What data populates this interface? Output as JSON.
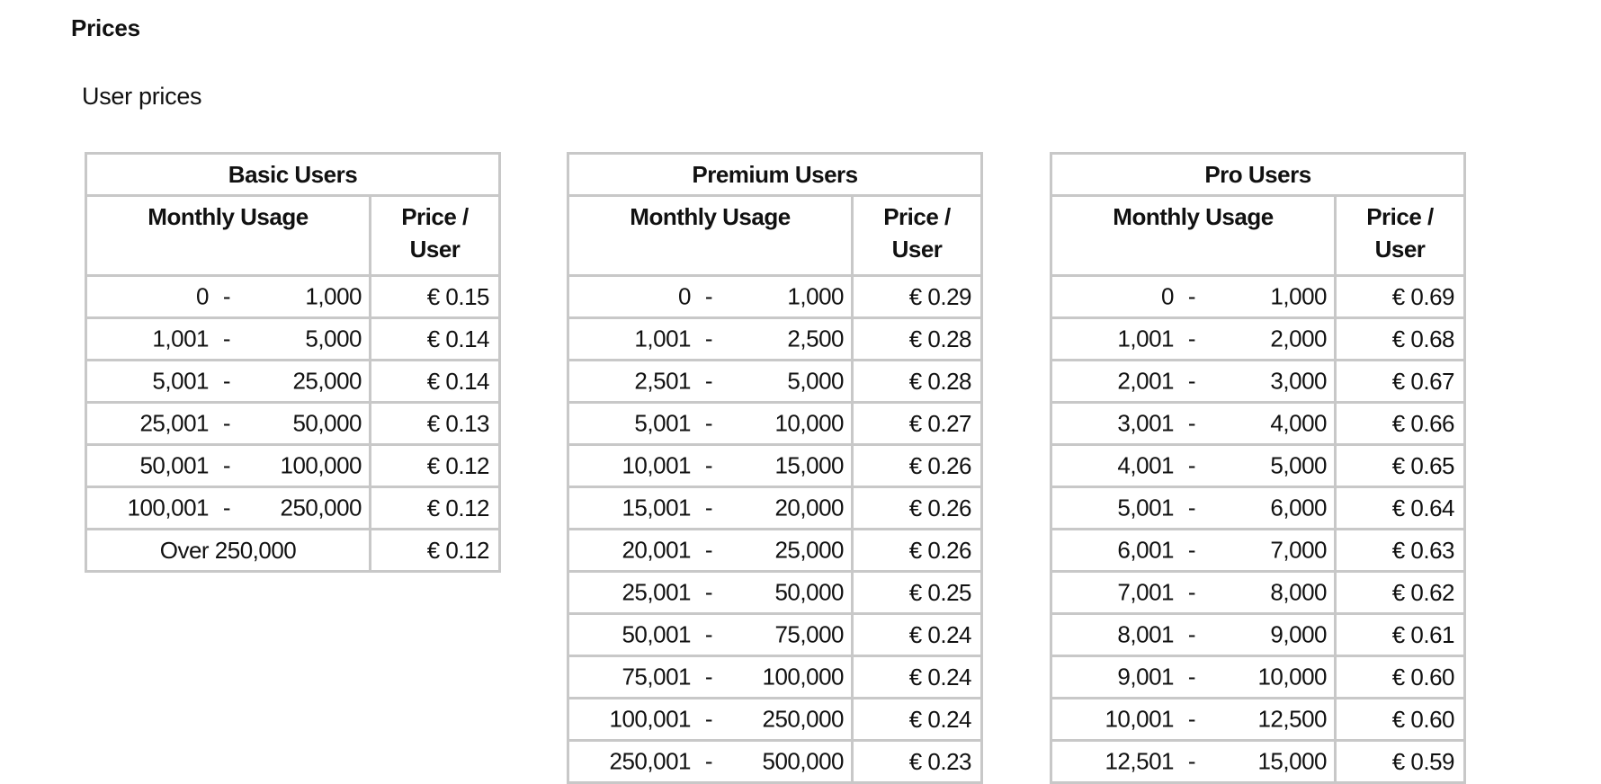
{
  "page": {
    "title": "Prices",
    "section_title": "User prices"
  },
  "columns": {
    "usage": "Monthly Usage",
    "price_line1": "Price /",
    "price_line2": "User"
  },
  "tables": [
    {
      "id": "basic",
      "title": "Basic Users",
      "rows": [
        {
          "from": "0",
          "to": "1,000",
          "price": "€ 0.15"
        },
        {
          "from": "1,001",
          "to": "5,000",
          "price": "€ 0.14"
        },
        {
          "from": "5,001",
          "to": "25,000",
          "price": "€ 0.14"
        },
        {
          "from": "25,001",
          "to": "50,000",
          "price": "€ 0.13"
        },
        {
          "from": "50,001",
          "to": "100,000",
          "price": "€ 0.12"
        },
        {
          "from": "100,001",
          "to": "250,000",
          "price": "€ 0.12"
        },
        {
          "label": "Over 250,000",
          "price": "€ 0.12"
        }
      ]
    },
    {
      "id": "premium",
      "title": "Premium Users",
      "rows": [
        {
          "from": "0",
          "to": "1,000",
          "price": "€ 0.29"
        },
        {
          "from": "1,001",
          "to": "2,500",
          "price": "€ 0.28"
        },
        {
          "from": "2,501",
          "to": "5,000",
          "price": "€ 0.28"
        },
        {
          "from": "5,001",
          "to": "10,000",
          "price": "€ 0.27"
        },
        {
          "from": "10,001",
          "to": "15,000",
          "price": "€ 0.26"
        },
        {
          "from": "15,001",
          "to": "20,000",
          "price": "€ 0.26"
        },
        {
          "from": "20,001",
          "to": "25,000",
          "price": "€ 0.26"
        },
        {
          "from": "25,001",
          "to": "50,000",
          "price": "€ 0.25"
        },
        {
          "from": "50,001",
          "to": "75,000",
          "price": "€ 0.24"
        },
        {
          "from": "75,001",
          "to": "100,000",
          "price": "€ 0.24"
        },
        {
          "from": "100,001",
          "to": "250,000",
          "price": "€ 0.24"
        },
        {
          "from": "250,001",
          "to": "500,000",
          "price": "€ 0.23"
        }
      ]
    },
    {
      "id": "pro",
      "title": "Pro Users",
      "rows": [
        {
          "from": "0",
          "to": "1,000",
          "price": "€ 0.69"
        },
        {
          "from": "1,001",
          "to": "2,000",
          "price": "€ 0.68"
        },
        {
          "from": "2,001",
          "to": "3,000",
          "price": "€ 0.67"
        },
        {
          "from": "3,001",
          "to": "4,000",
          "price": "€ 0.66"
        },
        {
          "from": "4,001",
          "to": "5,000",
          "price": "€ 0.65"
        },
        {
          "from": "5,001",
          "to": "6,000",
          "price": "€ 0.64"
        },
        {
          "from": "6,001",
          "to": "7,000",
          "price": "€ 0.63"
        },
        {
          "from": "7,001",
          "to": "8,000",
          "price": "€ 0.62"
        },
        {
          "from": "8,001",
          "to": "9,000",
          "price": "€ 0.61"
        },
        {
          "from": "9,001",
          "to": "10,000",
          "price": "€ 0.60"
        },
        {
          "from": "10,001",
          "to": "12,500",
          "price": "€ 0.60"
        },
        {
          "from": "12,501",
          "to": "15,000",
          "price": "€ 0.59"
        }
      ]
    }
  ],
  "range_separator": "-"
}
